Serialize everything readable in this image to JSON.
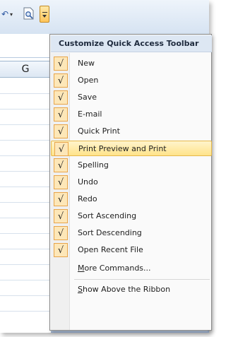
{
  "sheet": {
    "column_label": "G"
  },
  "menu": {
    "title": "Customize Quick Access Toolbar",
    "items": [
      {
        "label": "New",
        "checked": true,
        "check_glyph": "√"
      },
      {
        "label": "Open",
        "checked": true,
        "check_glyph": "√"
      },
      {
        "label": "Save",
        "checked": true,
        "check_glyph": "√"
      },
      {
        "label": "E-mail",
        "checked": true,
        "check_glyph": "√"
      },
      {
        "label": "Quick Print",
        "checked": true,
        "check_glyph": "√"
      },
      {
        "label": "Print Preview and Print",
        "checked": true,
        "highlighted": true,
        "check_glyph": "√"
      },
      {
        "label": "Spelling",
        "checked": true,
        "check_glyph": "√"
      },
      {
        "label": "Undo",
        "checked": true,
        "check_glyph": "√"
      },
      {
        "label": "Redo",
        "checked": true,
        "check_glyph": "√"
      },
      {
        "label": "Sort Ascending",
        "checked": true,
        "check_glyph": "√"
      },
      {
        "label": "Sort Descending",
        "checked": true,
        "check_glyph": "√"
      },
      {
        "label": "Open Recent File",
        "checked": true,
        "check_glyph": "√"
      }
    ],
    "more_commands": {
      "accesskey": "M",
      "rest": "ore Commands..."
    },
    "show_above": {
      "accesskey": "S",
      "rest": "how Above the Ribbon"
    }
  },
  "colors": {
    "highlight": "#ffe38a",
    "check_bg": "#fde7b8",
    "check_border": "#e8a54a",
    "header_bg": "#dde7f3"
  }
}
